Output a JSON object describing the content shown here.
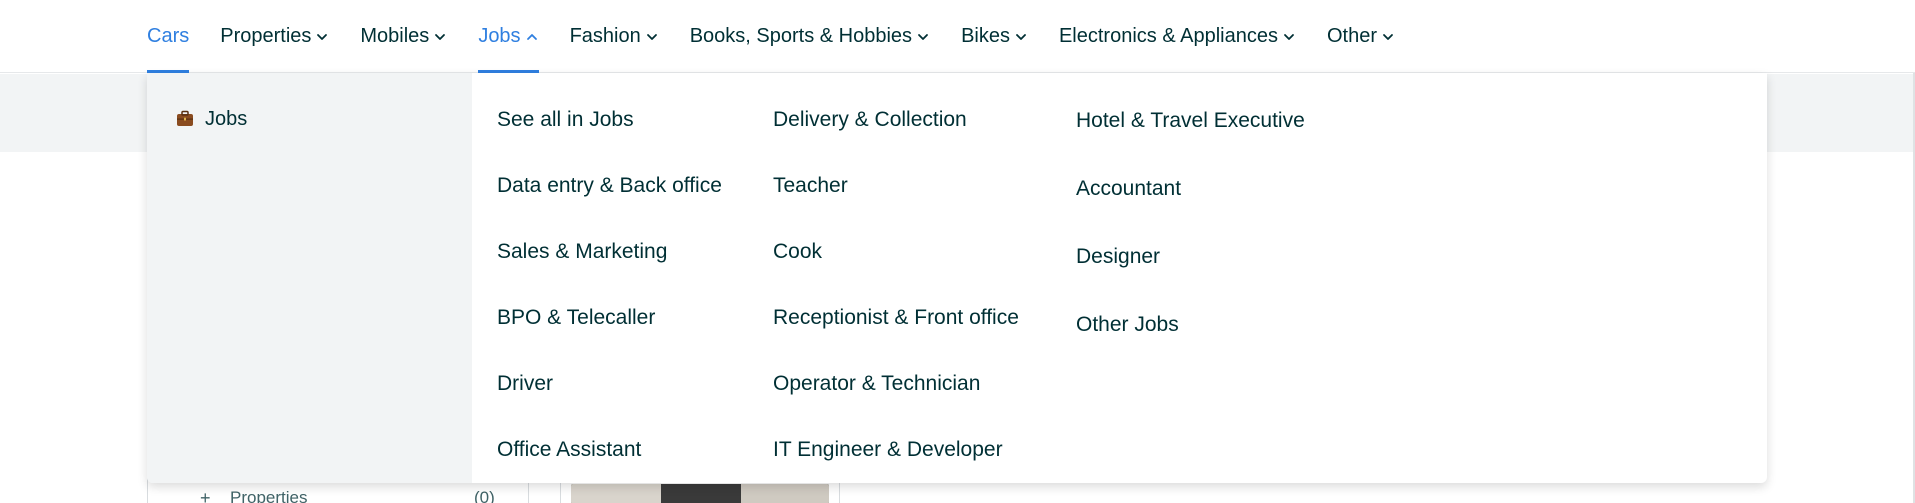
{
  "nav": {
    "items": [
      {
        "label": "Cars",
        "chevron": "none"
      },
      {
        "label": "Properties",
        "chevron": "down"
      },
      {
        "label": "Mobiles",
        "chevron": "down"
      },
      {
        "label": "Jobs",
        "chevron": "up"
      },
      {
        "label": "Fashion",
        "chevron": "down"
      },
      {
        "label": "Books, Sports & Hobbies",
        "chevron": "down"
      },
      {
        "label": "Bikes",
        "chevron": "down"
      },
      {
        "label": "Electronics & Appliances",
        "chevron": "down"
      },
      {
        "label": "Other",
        "chevron": "down"
      }
    ],
    "active_item": "Jobs"
  },
  "dropdown": {
    "category": {
      "label": "Jobs",
      "icon": "briefcase-icon"
    },
    "columns": [
      [
        "See all in Jobs",
        "Data entry & Back office",
        "Sales & Marketing",
        "BPO & Telecaller",
        "Driver",
        "Office Assistant"
      ],
      [
        "Delivery & Collection",
        "Teacher",
        "Cook",
        "Receptionist & Front office",
        "Operator & Technician",
        "IT Engineer & Developer"
      ],
      [
        "Hotel & Travel Executive",
        "Accountant",
        "Designer",
        "Other Jobs"
      ]
    ]
  },
  "background": {
    "filter_row": {
      "icon": "+",
      "label": "Properties",
      "count": "(0)"
    }
  },
  "colors": {
    "accent": "#2f7fe0",
    "text": "#002f34",
    "panel_grey": "#f2f4f5"
  }
}
